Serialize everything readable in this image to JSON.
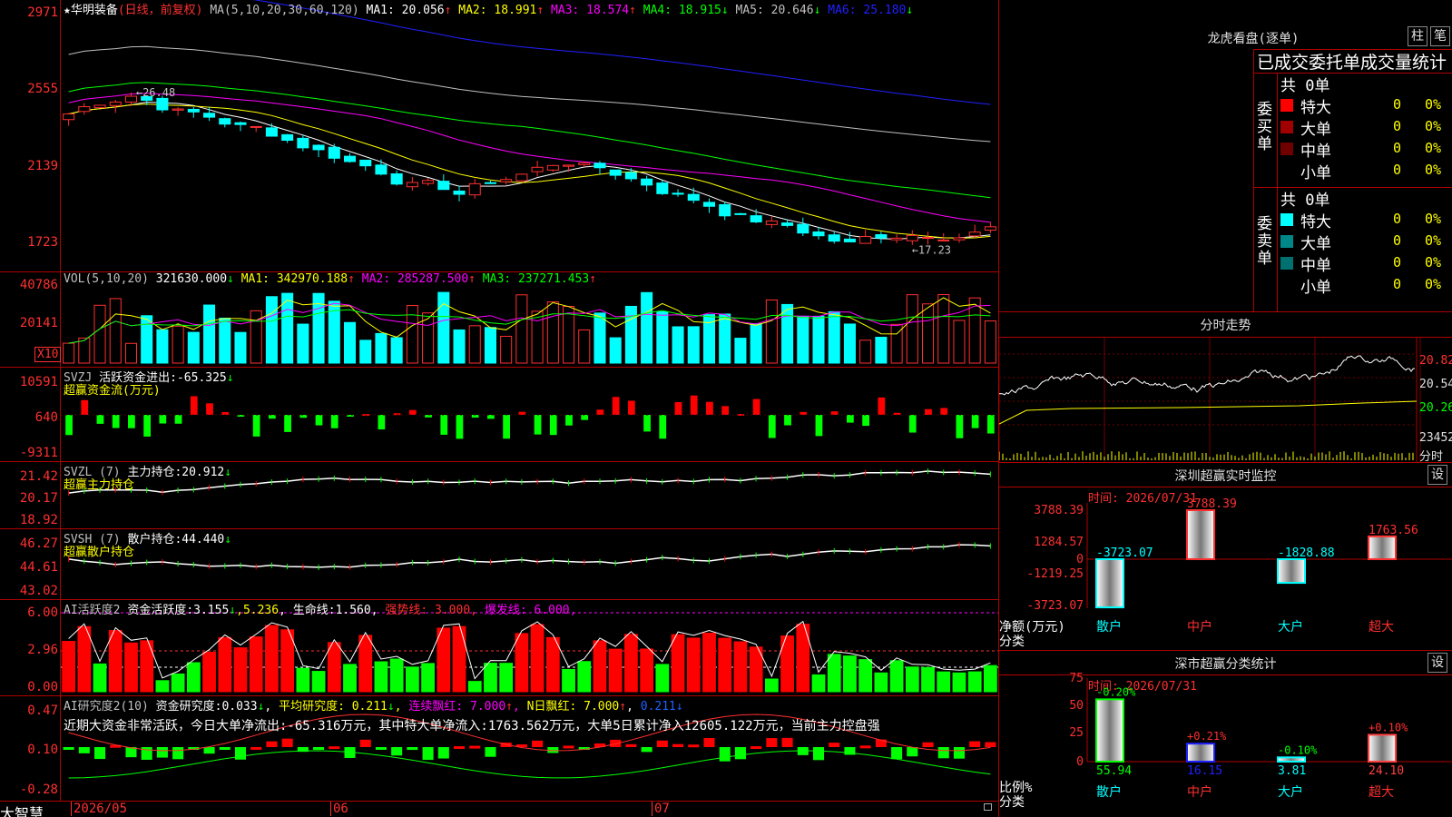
{
  "stock": {
    "name": "华明装备",
    "star": "★",
    "mode": "(日线，前复权)"
  },
  "main_ma": {
    "label": "MA(5,10,20,30,60,120)",
    "items": [
      {
        "name": "MA1",
        "value": "20.056",
        "arrow": "↑",
        "color": "#ffffff"
      },
      {
        "name": "MA2",
        "value": "18.991",
        "arrow": "↑",
        "color": "#ffff00"
      },
      {
        "name": "MA3",
        "value": "18.574",
        "arrow": "↑",
        "color": "#ff00ff"
      },
      {
        "name": "MA4",
        "value": "18.915",
        "arrow": "↓",
        "color": "#00ff00"
      },
      {
        "name": "MA5",
        "value": "20.646",
        "arrow": "↓",
        "color": "#c0c0c0"
      },
      {
        "name": "MA6",
        "value": "25.180",
        "arrow": "↓",
        "color": "#2020ff"
      }
    ],
    "y_ticks": [
      "2971",
      "2555",
      "2139",
      "1723"
    ],
    "hi_label": "26.48",
    "lo_label": "17.23"
  },
  "vol": {
    "label": "VOL(5,10,20)",
    "value": "321630.000",
    "arrow": "↓",
    "items": [
      {
        "name": "MA1",
        "value": "342970.188",
        "arrow": "↑",
        "color": "#ffff00"
      },
      {
        "name": "MA2",
        "value": "285287.500",
        "arrow": "↑",
        "color": "#ff00ff"
      },
      {
        "name": "MA3",
        "value": "237271.453",
        "arrow": "↑",
        "color": "#00ff00"
      }
    ],
    "y_ticks": [
      "40786",
      "20141"
    ],
    "unit": "X10"
  },
  "svzj": {
    "label": "SVZJ",
    "sub": "活跃资金进出:",
    "value": "-65.325",
    "arrow": "↓",
    "name2": "超赢资金流(万元)",
    "y_ticks": [
      "10591",
      "640",
      "-9311"
    ]
  },
  "svzl": {
    "label": "SVZL (7)",
    "sub": "主力持仓:",
    "value": "20.912",
    "arrow": "↓",
    "name2": "超赢主力持仓",
    "y_ticks": [
      "21.42",
      "20.17",
      "18.92"
    ]
  },
  "svsh": {
    "label": "SVSH (7)",
    "sub": "散户持仓:",
    "value": "44.440",
    "arrow": "↓",
    "name2": "超赢散户持仓",
    "y_ticks": [
      "46.27",
      "44.61",
      "43.02"
    ]
  },
  "ai1": {
    "label": "AI活跃度2",
    "sub": "资金活跃度:",
    "v1": "3.155",
    "a1": "↓",
    "v2": "5.236",
    "life_label": "生命线:",
    "life": "1.560",
    "strong": "强势线: 3.000",
    "burst": "爆发线: 6.000",
    "y_ticks": [
      "6.00",
      "2.96",
      "0.00"
    ]
  },
  "ai2": {
    "label": "AI研究度2(10)",
    "sub": "资金研究度:",
    "v1": "0.033",
    "a1": "↓",
    "avg": "平均研究度: 0.211",
    "avg_a": "↓",
    "cont": "连续飘红: 7.000",
    "cont_a": "↑",
    "nday": "N日飘红: 7.000",
    "nday_a": "↑",
    "v4": "0.211",
    "v4_a": "↓",
    "comment": "近期大资金非常活跃，今日大单净流出:-65.316万元，其中特大单净流入:1763.562万元，大单5日累计净入12605.122万元，当前主力控盘强",
    "y_ticks": [
      "0.47",
      "0.10",
      "-0.28"
    ]
  },
  "footer": {
    "brand": "大智慧",
    "dates": [
      "2026/05",
      "06",
      "07"
    ]
  },
  "lhkp": {
    "title": "龙虎看盘(逐单)",
    "btn1": "柱",
    "btn2": "笔",
    "subtitle": "已成交委托单成交量统计",
    "buy": {
      "side_label": "委买单",
      "total": "共 0单",
      "rows": [
        {
          "name": "特大",
          "value": "0",
          "pct": "0%",
          "color": "#ff0000"
        },
        {
          "name": "大单",
          "value": "0",
          "pct": "0%",
          "color": "#a00000"
        },
        {
          "name": "中单",
          "value": "0",
          "pct": "0%",
          "color": "#700000"
        },
        {
          "name": "小单",
          "value": "0",
          "pct": "0%",
          "color": ""
        }
      ]
    },
    "sell": {
      "side_label": "委卖单",
      "total": "共 0单",
      "rows": [
        {
          "name": "特大",
          "value": "0",
          "pct": "0%",
          "color": "#00ffff"
        },
        {
          "name": "大单",
          "value": "0",
          "pct": "0%",
          "color": "#008888"
        },
        {
          "name": "中单",
          "value": "0",
          "pct": "0%",
          "color": "#007070"
        },
        {
          "name": "小单",
          "value": "0",
          "pct": "0%",
          "color": ""
        }
      ]
    }
  },
  "intraday": {
    "title": "分时走势",
    "y_ticks": [
      "20.82",
      "20.54",
      "20.26"
    ],
    "vol_tick": "23452",
    "label": "分时"
  },
  "sz_monitor": {
    "title": "深圳超赢实时监控",
    "btn": "设",
    "time": "时间: 2026/07/31",
    "y_ticks": [
      "3788.39",
      "1284.57",
      "0",
      "-1219.25",
      "-3723.07"
    ],
    "y_caption": "净额(万元)",
    "x_caption": "分类",
    "bars": [
      {
        "cat": "散户",
        "value": -3723.07,
        "label": "-3723.07"
      },
      {
        "cat": "中户",
        "value": 3788.39,
        "label": "3788.39"
      },
      {
        "cat": "大户",
        "value": -1828.88,
        "label": "-1828.88"
      },
      {
        "cat": "超大",
        "value": 1763.56,
        "label": "1763.56"
      }
    ]
  },
  "sz_class": {
    "title": "深市超赢分类统计",
    "btn": "设",
    "time": "时间: 2026/07/31",
    "y_ticks": [
      "75",
      "50",
      "25",
      "0"
    ],
    "y_caption": "比例%",
    "x_caption": "分类",
    "bars": [
      {
        "cat": "散户",
        "value": 55.94,
        "label": "55.94",
        "delta": "-0.20%",
        "color": "#00ff00"
      },
      {
        "cat": "中户",
        "value": 16.15,
        "label": "16.15",
        "delta": "+0.21%",
        "color": "#2020ff"
      },
      {
        "cat": "大户",
        "value": 3.81,
        "label": "3.81",
        "delta": "-0.10%",
        "color": "#00ffff"
      },
      {
        "cat": "超大",
        "value": 24.1,
        "label": "24.10",
        "delta": "+0.10%",
        "color": "#ff4040"
      }
    ]
  }
}
